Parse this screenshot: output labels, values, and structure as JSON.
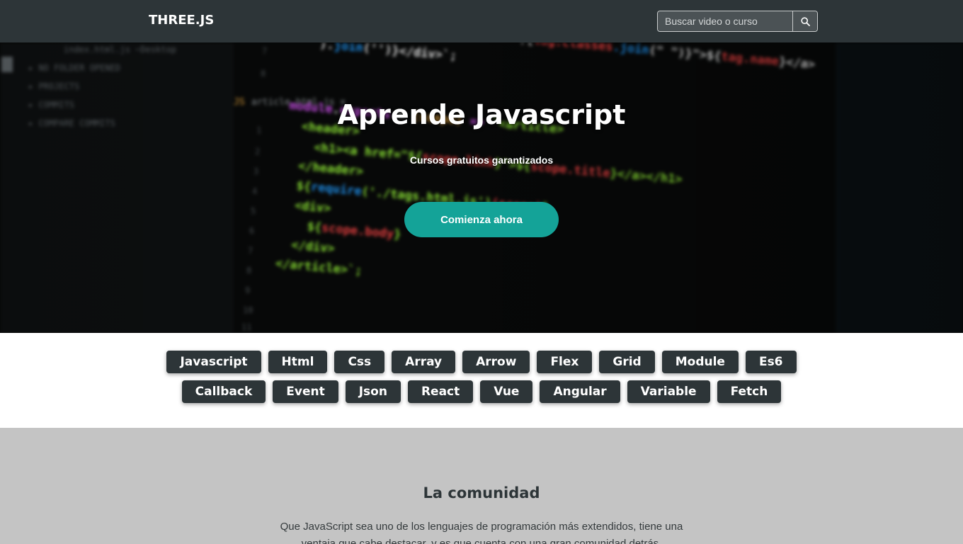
{
  "navbar": {
    "brand": "THREE.JS",
    "search": {
      "placeholder": "Buscar video o curso",
      "button_icon": "search-icon"
    }
  },
  "hero": {
    "title": "Aprende Javascript",
    "subtitle": "Cursos gratuitos garantizados",
    "cta_label": "Comienza ahora",
    "accent_color": "#14a398"
  },
  "tags": {
    "row1": [
      "Javascript",
      "Html",
      "Css",
      "Array",
      "Arrow",
      "Flex",
      "Grid",
      "Module",
      "Es6"
    ],
    "row2": [
      "Callback",
      "Event",
      "Json",
      "React",
      "Vue",
      "Angular",
      "Variable",
      "Fetch"
    ]
  },
  "community": {
    "title": "La comunidad",
    "text": "Que JavaScript sea uno de los lenguajes de programación más extendidos, tiene una ventaja que cabe destacar, y es que cuenta con una gran comunidad detrás."
  },
  "colors": {
    "navbar": "#2d3538",
    "tag_bg": "#2d3538",
    "community_bg": "#c4c4c4"
  }
}
